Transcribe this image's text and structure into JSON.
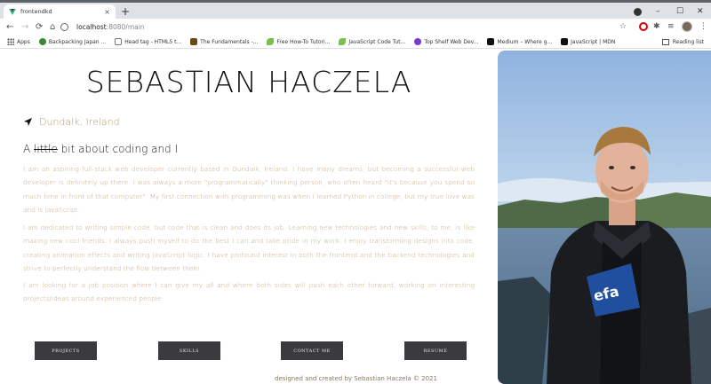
{
  "browser": {
    "tab_title": "frontendkd",
    "tab_close": "×",
    "new_tab": "+",
    "window_controls": {
      "minimize": "–",
      "maximize": "☐",
      "close": "✕"
    },
    "nav": {
      "back": "←",
      "forward": "→",
      "reload": "⟳",
      "home": "⌂"
    },
    "url_host": "localhost",
    "url_rest": ":8080/main",
    "toolbar_icons": {
      "star": "☆",
      "extensions": "✱",
      "menu": "⋮",
      "queue": "≡"
    },
    "bookmarks": [
      {
        "label": "Apps",
        "icon": "apps-grid-icon"
      },
      {
        "label": "Backpacking Japan ...",
        "icon": "globe-icon",
        "color": "#3a8a3a"
      },
      {
        "label": "Head tag - HTML5 t...",
        "icon": "dev-icon",
        "color": "#777777"
      },
      {
        "label": "The Fundamentals -...",
        "icon": "book-icon",
        "color": "#6b4a1a"
      },
      {
        "label": "Free How-To Tutori...",
        "icon": "leaf-icon",
        "color": "#7ac04a"
      },
      {
        "label": "JavaScript Code Tut...",
        "icon": "leaf-icon",
        "color": "#7ac04a"
      },
      {
        "label": "Top Shelf Web Dev...",
        "icon": "circle-icon",
        "color": "#7a3ad0"
      },
      {
        "label": "Medium – Where g...",
        "icon": "medium-icon",
        "color": "#111111"
      },
      {
        "label": "JavaScript | MDN",
        "icon": "mdn-icon",
        "color": "#111111"
      }
    ],
    "reading_list": "Reading list"
  },
  "page": {
    "name": "SEBASTIAN HACZELA",
    "location": "Dundalk, Ireland",
    "about_prefix": "A",
    "about_strike": "little",
    "about_suffix": "bit about coding and I",
    "paragraphs": [
      "I am an aspiring full-stack web developer currently based in Dundalk, Ireland. I have many dreams, but becoming a successful web developer is definitely up there. I was always a more \"programmatically\" thinking person, who often heard \"it's because you spend so much time in front of that computer\". My first connection with programming was when I learned Python in college, but my true love was and is JavaScript.",
      "I am dedicated to writing simple code, but code that is clean and does its job. Learning new technologies and new skills, to me, is like making new cool friends. I always push myself to do the best I can and take pride in my work. I enjoy transforming designs into code, creating animation effects and writing JavaScript logic. I have profound interest in both the frontend and the backend technologies and strive to perfectly understand the flow between them.",
      "I am looking for a job position where I can give my all and where both sides will push each other forward, working on interesting projects/ideas around experienced people."
    ],
    "buttons": {
      "projects": "PROJECTS",
      "skills": "SKILLS",
      "contact": "CONTACT ME",
      "resume": "RESUME"
    },
    "footer": "designed and created by Sebastian Haczela © 2021"
  },
  "colors": {
    "accent_text": "#c3a67e",
    "location_text": "#b79a6e",
    "button_bg": "#3b3b3f"
  }
}
